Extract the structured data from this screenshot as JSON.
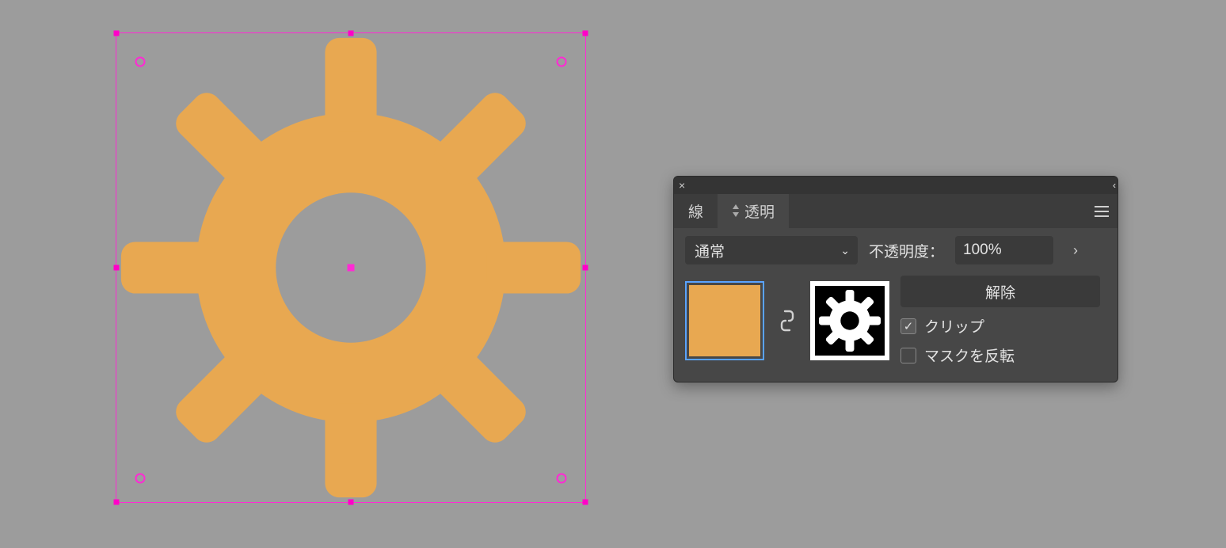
{
  "canvas": {
    "artwork_kind": "gear-icon",
    "fill_color": "#e8a851",
    "selection_color": "#ff2ad4"
  },
  "panel": {
    "close_glyph": "×",
    "collapse_glyph": "‹‹",
    "tabs": {
      "stroke": "線",
      "transparency_prefix": "◇",
      "transparency": "透明"
    },
    "blend_mode": {
      "selected": "通常",
      "chevron": "⌄"
    },
    "opacity": {
      "label": "不透明度：",
      "value": "100%",
      "more_glyph": "›"
    },
    "mask": {
      "link_glyph": "🔗",
      "release_label": "解除",
      "clip_label": "クリップ",
      "invert_label": "マスクを反転",
      "clip_checked": true,
      "invert_checked": false
    }
  }
}
